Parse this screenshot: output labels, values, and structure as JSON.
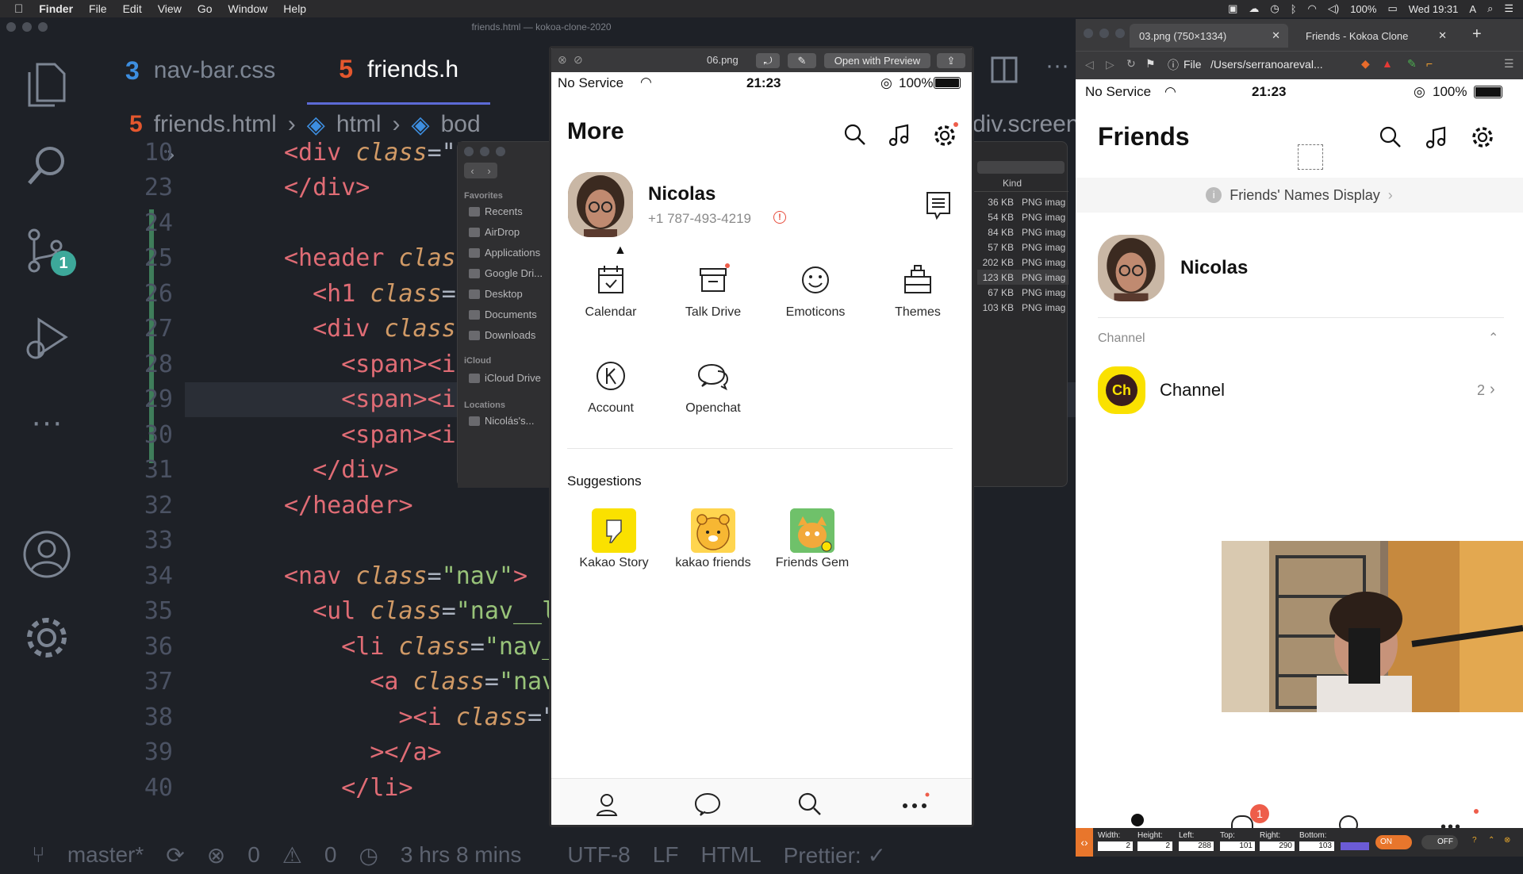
{
  "menubar": {
    "app": "Finder",
    "items": [
      "File",
      "Edit",
      "View",
      "Go",
      "Window",
      "Help"
    ],
    "battery": "100%",
    "clock": "Wed 19:31"
  },
  "vscode": {
    "title": "friends.html — kokoa-clone-2020",
    "tabs": [
      {
        "label": "nav-bar.css",
        "active": false
      },
      {
        "label": "friends.h",
        "active": true
      }
    ],
    "breadcrumb": [
      "friends.html",
      "html",
      "bod",
      "div.screen"
    ],
    "scm_badge": "1",
    "lines": [
      {
        "n": "10",
        "parts": [
          [
            "tag",
            "<div "
          ],
          [
            "attr",
            "class"
          ],
          [
            "punct",
            "=\""
          ]
        ]
      },
      {
        "n": "23",
        "parts": [
          [
            "tag",
            "</div>"
          ]
        ]
      },
      {
        "n": "24",
        "parts": []
      },
      {
        "n": "25",
        "parts": [
          [
            "tag",
            "<header "
          ],
          [
            "attr",
            "clas"
          ]
        ]
      },
      {
        "n": "26",
        "parts": [
          [
            "tag",
            "  <h1 "
          ],
          [
            "attr",
            "class"
          ],
          [
            "punct",
            "="
          ]
        ]
      },
      {
        "n": "27",
        "parts": [
          [
            "tag",
            "  <div "
          ],
          [
            "attr",
            "class"
          ]
        ]
      },
      {
        "n": "28",
        "parts": [
          [
            "tag",
            "    <span><i"
          ]
        ]
      },
      {
        "n": "29",
        "parts": [
          [
            "tag",
            "    <span><i"
          ]
        ]
      },
      {
        "n": "30",
        "parts": [
          [
            "tag",
            "    <span><i"
          ]
        ]
      },
      {
        "n": "31",
        "parts": [
          [
            "tag",
            "  </div>"
          ]
        ]
      },
      {
        "n": "32",
        "parts": [
          [
            "tag",
            "</header>"
          ]
        ]
      },
      {
        "n": "33",
        "parts": []
      },
      {
        "n": "34",
        "parts": [
          [
            "tag",
            "<nav "
          ],
          [
            "attr",
            "class"
          ],
          [
            "punct",
            "="
          ],
          [
            "str",
            "\"nav\""
          ],
          [
            "tag",
            ">"
          ]
        ]
      },
      {
        "n": "35",
        "parts": [
          [
            "tag",
            "  <ul "
          ],
          [
            "attr",
            "class"
          ],
          [
            "punct",
            "="
          ],
          [
            "str",
            "\"nav__l"
          ]
        ]
      },
      {
        "n": "36",
        "parts": [
          [
            "tag",
            "    <li "
          ],
          [
            "attr",
            "class"
          ],
          [
            "punct",
            "="
          ],
          [
            "str",
            "\"nav_"
          ]
        ]
      },
      {
        "n": "37",
        "parts": [
          [
            "tag",
            "      <a "
          ],
          [
            "attr",
            "class"
          ],
          [
            "punct",
            "="
          ],
          [
            "str",
            "\"nav"
          ]
        ]
      },
      {
        "n": "38",
        "parts": [
          [
            "tag",
            "        ><i "
          ],
          [
            "attr",
            "class"
          ],
          [
            "punct",
            "=\""
          ]
        ]
      },
      {
        "n": "39",
        "parts": [
          [
            "tag",
            "      ></a>"
          ]
        ]
      },
      {
        "n": "40",
        "parts": [
          [
            "tag",
            "    </li>"
          ]
        ]
      }
    ],
    "status": {
      "branch": "master*",
      "errors": "0",
      "warnings": "0",
      "time": "3 hrs 8 mins",
      "encoding": "UTF-8",
      "eol": "LF",
      "lang": "HTML",
      "prettier": "Prettier: ✓"
    }
  },
  "finder": {
    "favorites_label": "Favorites",
    "favorites": [
      "Recents",
      "AirDrop",
      "Applications",
      "Google Dri...",
      "Desktop",
      "Documents",
      "Downloads"
    ],
    "icloud_label": "iCloud",
    "icloud": [
      "iCloud Drive"
    ],
    "locations_label": "Locations",
    "locations": [
      "Nicolás's..."
    ],
    "kind_header": "Kind",
    "files": [
      {
        "size": "36 KB",
        "kind": "PNG imag"
      },
      {
        "size": "54 KB",
        "kind": "PNG imag"
      },
      {
        "size": "84 KB",
        "kind": "PNG imag"
      },
      {
        "size": "57 KB",
        "kind": "PNG imag"
      },
      {
        "size": "202 KB",
        "kind": "PNG imag"
      },
      {
        "size": "123 KB",
        "kind": "PNG imag"
      },
      {
        "size": "67 KB",
        "kind": "PNG imag"
      },
      {
        "size": "103 KB",
        "kind": "PNG imag"
      }
    ]
  },
  "preview": {
    "filename": "06.png",
    "open_with": "Open with Preview",
    "phone": {
      "carrier": "No Service",
      "time": "21:23",
      "battery": "100%",
      "title": "More",
      "profile_name": "Nicolas",
      "profile_phone": "+1 787-493-4219",
      "grid": [
        "Calendar",
        "Talk Drive",
        "Emoticons",
        "Themes",
        "Account",
        "Openchat"
      ],
      "suggestions_title": "Suggestions",
      "suggestions": [
        "Kakao Story",
        "kakao friends",
        "Friends Gem"
      ]
    }
  },
  "browser": {
    "tabs": [
      "03.png (750×1334)",
      "Friends - Kokoa Clone"
    ],
    "url_scheme": "File",
    "url_path": "/Users/serranoareval...",
    "phone": {
      "carrier": "No Service",
      "time": "21:23",
      "battery": "100%",
      "title": "Friends",
      "names_display": "Friends' Names Display",
      "profile_name": "Nicolas",
      "channel_section": "Channel",
      "channel_icon_text": "Ch",
      "channel_label": "Channel",
      "channel_count": "2",
      "chat_badge": "1"
    },
    "measure": {
      "labels": [
        "Width:",
        "Height:",
        "Left:",
        "Top:",
        "Right:",
        "Bottom:"
      ],
      "values": [
        "2",
        "2",
        "288",
        "101",
        "290",
        "103"
      ],
      "on": "ON",
      "off": "OFF"
    }
  },
  "colors": {
    "accent": "#5c6ad6",
    "kakao_yellow": "#fae100",
    "badge_red": "#ee5d4a",
    "notify_red": "#e74c3c"
  }
}
